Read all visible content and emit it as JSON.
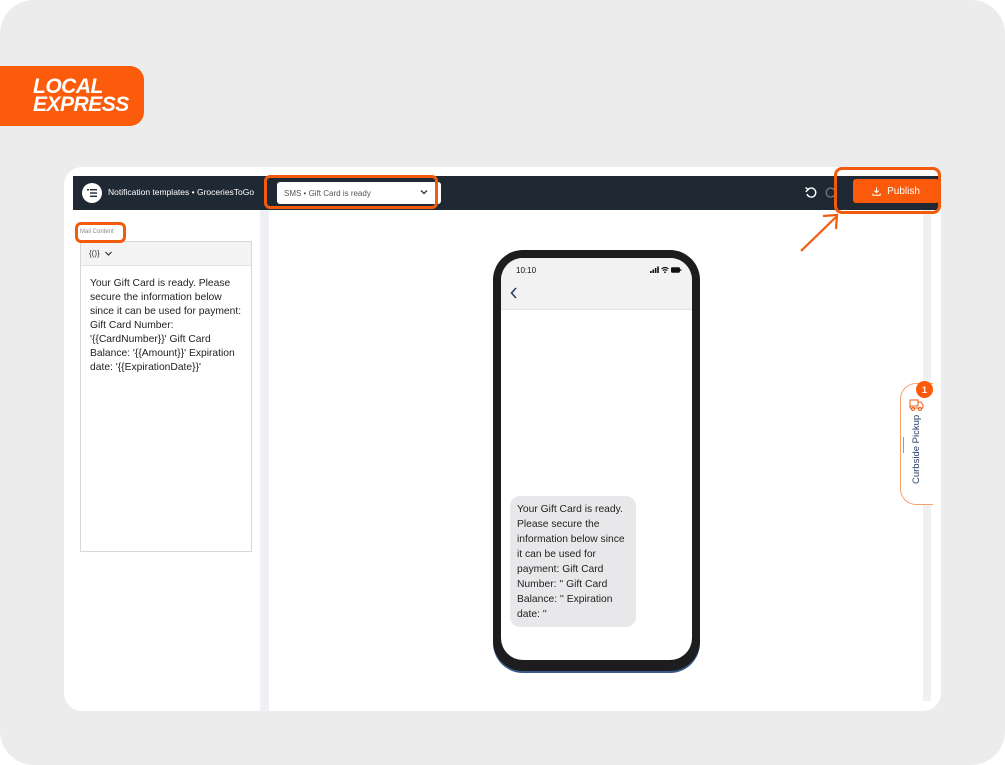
{
  "brand": {
    "logo_line1": "LOCAL",
    "logo_line2": "EXPRESS",
    "accent_color": "#FA5A0A"
  },
  "header": {
    "title": "Notification templates • GroceriesToGo",
    "template_select_value": "SMS • Gift Card is ready",
    "publish_label": "Publish",
    "icons": [
      "menu-icon",
      "undo-icon",
      "redo-icon",
      "download-icon"
    ]
  },
  "editor": {
    "section_label": "Mail Content",
    "variables_button": "{()}",
    "content": "Your Gift Card is ready. Please secure the information below since it can be used for payment: Gift Card Number: '{{CardNumber}}' Gift Card Balance: '{{Amount}}' Expiration date: '{{ExpirationDate}}'"
  },
  "preview": {
    "time": "10:10",
    "message": "Your Gift Card is ready. Please secure the information below since it can be used for payment: Gift Card Number: '' Gift Card Balance: '' Expiration date: ''"
  },
  "curbside": {
    "label": "Curbside Pickup",
    "count": "1"
  }
}
